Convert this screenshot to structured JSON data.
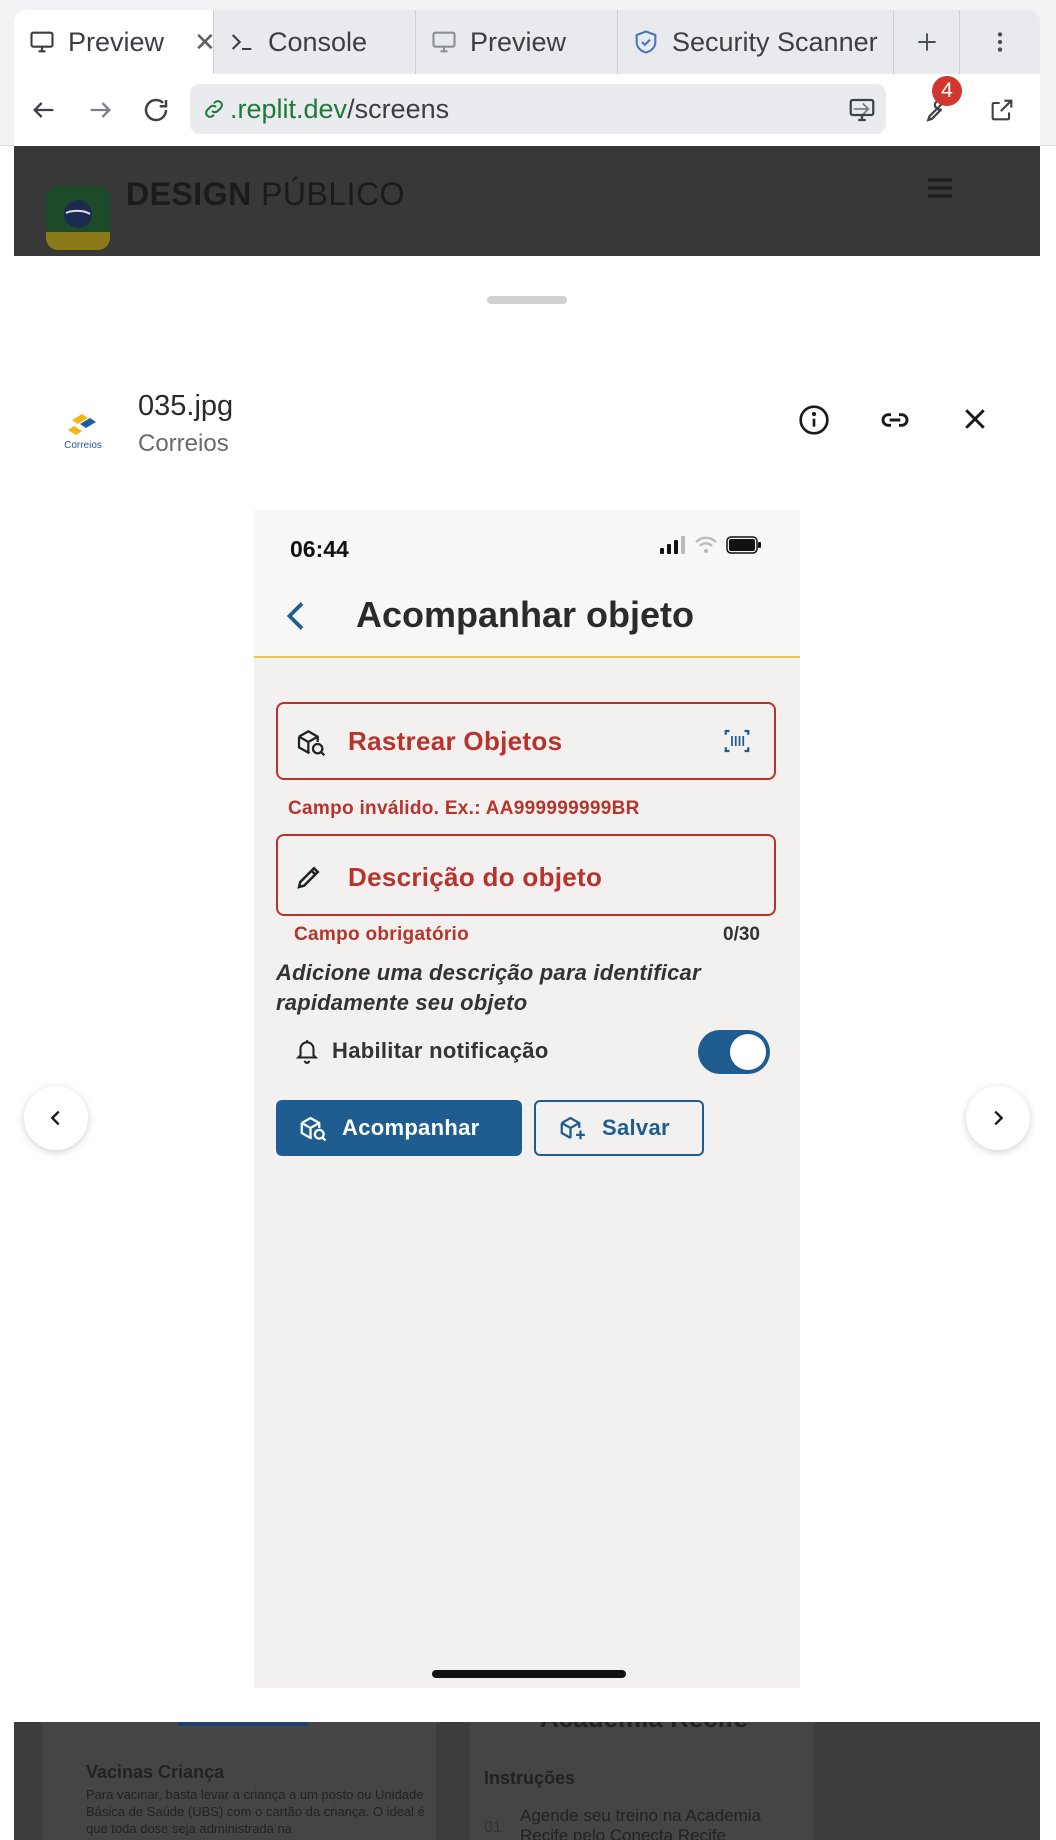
{
  "browser": {
    "tabs": [
      {
        "label": "Preview",
        "active": true,
        "icon": "monitor-icon"
      },
      {
        "label": "Console",
        "active": false,
        "icon": "terminal-icon"
      },
      {
        "label": "Preview",
        "active": false,
        "icon": "monitor-icon"
      },
      {
        "label": "Security Scanner",
        "active": false,
        "icon": "shield-icon"
      }
    ],
    "url_domain": ".replit.dev",
    "url_path": "/screens",
    "badge_count": "4"
  },
  "site": {
    "title_bold": "DESIGN",
    "title_regular": "PÚBLICO"
  },
  "viewer": {
    "file_name": "035.jpg",
    "organization": "Correios",
    "logo_text": "Correios"
  },
  "background": {
    "card1_title": "Vacinas Criança",
    "card1_text": "Para vacinar, basta levar a criança a um posto ou Unidade Básica de Saúde (UBS) com o cartão da criança. O ideal é que toda dose seja administrada na",
    "card2_heading": "Academia Recife",
    "card2_title": "Instruções",
    "card2_number": "01",
    "card2_text": "Agende seu treino na Academia Recife pelo Conecta Recife"
  },
  "phone": {
    "time": "06:44",
    "title": "Acompanhar objeto",
    "track_field_label": "Rastrear Objetos",
    "track_field_error": "Campo inválido. Ex.: AA999999999BR",
    "desc_field_label": "Descrição do objeto",
    "desc_field_error": "Campo obrigatório",
    "desc_counter": "0/30",
    "hint": "Adicione uma descrição para identificar rapidamente seu objeto",
    "notification_label": "Habilitar notificação",
    "notification_enabled": true,
    "primary_button": "Acompanhar",
    "secondary_button": "Salvar"
  },
  "colors": {
    "error": "#b8332c",
    "primary": "#1f5d90",
    "accent_line": "#e9c34a"
  }
}
